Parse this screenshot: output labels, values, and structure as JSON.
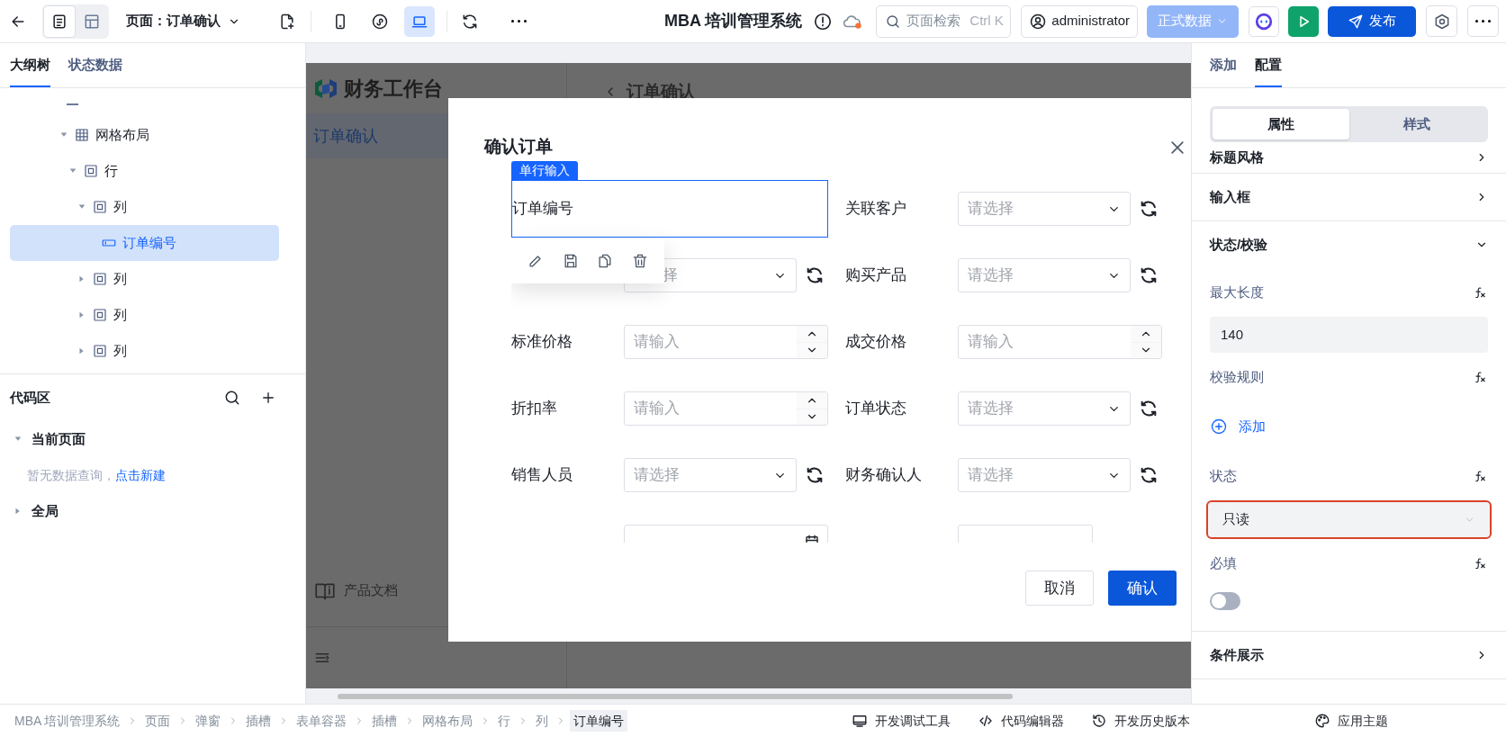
{
  "topbar": {
    "view_modes": [
      {
        "kind": "outline",
        "selected": true
      },
      {
        "kind": "layout",
        "selected": false
      }
    ],
    "page_selector": "页面：订单确认",
    "devices": [
      {
        "kind": "mobile",
        "selected": false
      },
      {
        "kind": "miniprogram",
        "selected": false
      },
      {
        "kind": "desktop",
        "selected": true
      }
    ],
    "app_title": "MBA 培训管理系统",
    "search": {
      "placeholder": "页面检索",
      "shortcut": "Ctrl K"
    },
    "user": "administrator",
    "data_env": {
      "label": "正式数据",
      "disabled": true
    },
    "publish": "发布"
  },
  "left_panel": {
    "tabs": [
      {
        "label": "大纲树",
        "selected": true
      },
      {
        "label": "状态数据",
        "selected": false
      }
    ],
    "tree": [
      {
        "label": "网格布局",
        "kind": "grid",
        "expanded": true,
        "selected": false,
        "children": [
          {
            "label": "行",
            "kind": "container",
            "expanded": true,
            "selected": false,
            "children": [
              {
                "label": "列",
                "kind": "container",
                "expanded": true,
                "selected": false,
                "children": [
                  {
                    "label": "订单编号",
                    "kind": "input",
                    "selected": true
                  }
                ]
              },
              {
                "label": "列",
                "kind": "container",
                "expanded": false,
                "selected": false
              },
              {
                "label": "列",
                "kind": "container",
                "expanded": false,
                "selected": false
              },
              {
                "label": "列",
                "kind": "container",
                "expanded": false,
                "selected": false
              }
            ]
          }
        ]
      }
    ],
    "code_area": {
      "title": "代码区",
      "groups": [
        {
          "label": "当前页面",
          "expanded": true,
          "empty_text": "暂无数据查询，",
          "link": "点击新建"
        },
        {
          "label": "全局",
          "expanded": false
        }
      ]
    }
  },
  "canvas": {
    "preview": {
      "logo_text": "财务工作台",
      "menu": [
        {
          "label": "订单确认",
          "selected": true
        }
      ],
      "docs_link": "产品文档",
      "header_title": "订单确认"
    },
    "modal": {
      "title": "确认订单",
      "selected_tag": "单行输入",
      "fields": [
        {
          "kind": "text",
          "label": "订单编号",
          "selected": true
        },
        {
          "kind": "select",
          "label": "关联客户",
          "placeholder": "请选择",
          "selected": false
        },
        {
          "kind": "select",
          "placeholder": "择",
          "selected": false
        },
        {
          "kind": "select",
          "label": "购买产品",
          "placeholder": "请选择",
          "selected": false
        },
        {
          "kind": "number",
          "label": "标准价格",
          "placeholder": "请输入",
          "selected": false
        },
        {
          "kind": "number",
          "label": "成交价格",
          "placeholder": "请输入",
          "selected": false
        },
        {
          "kind": "number",
          "label": "折扣率",
          "placeholder": "请输入",
          "selected": false
        },
        {
          "kind": "select",
          "label": "订单状态",
          "placeholder": "请选择",
          "selected": false
        },
        {
          "kind": "select",
          "label": "销售人员",
          "placeholder": "请选择",
          "selected": false
        },
        {
          "kind": "select",
          "label": "财务确认人",
          "placeholder": "请选择",
          "selected": false
        },
        {
          "kind": "date",
          "selected": false
        },
        {
          "kind": "input",
          "selected": false
        }
      ],
      "buttons": [
        {
          "label": "取消",
          "kind": "secondary"
        },
        {
          "label": "确认",
          "kind": "primary"
        }
      ]
    }
  },
  "right_panel": {
    "tabs": [
      {
        "label": "添加",
        "selected": false
      },
      {
        "label": "配置",
        "selected": true
      }
    ],
    "segments": [
      {
        "label": "属性",
        "selected": true
      },
      {
        "label": "样式",
        "selected": false
      }
    ],
    "sections": [
      {
        "title": "标题风格",
        "expanded": false
      },
      {
        "title": "输入框",
        "expanded": false
      },
      {
        "title": "状态/校验",
        "expanded": true,
        "props": [
          {
            "kind": "input",
            "label": "最大长度",
            "value": "140"
          },
          {
            "kind": "rules",
            "label": "校验规则",
            "action": "添加"
          },
          {
            "kind": "select",
            "label": "状态",
            "value": "只读",
            "highlighted": true
          },
          {
            "kind": "switch",
            "label": "必填",
            "on": false
          }
        ]
      },
      {
        "title": "条件展示",
        "expanded": false
      }
    ]
  },
  "status_bar": {
    "breadcrumb": [
      {
        "label": "MBA 培训管理系统",
        "selected": false
      },
      {
        "label": "页面",
        "selected": false
      },
      {
        "label": "弹窗",
        "selected": false
      },
      {
        "label": "插槽",
        "selected": false
      },
      {
        "label": "表单容器",
        "selected": false
      },
      {
        "label": "插槽",
        "selected": false
      },
      {
        "label": "网格布局",
        "selected": false
      },
      {
        "label": "行",
        "selected": false
      },
      {
        "label": "列",
        "selected": false
      },
      {
        "label": "订单编号",
        "selected": true
      }
    ],
    "tools": [
      {
        "kind": "debug",
        "label": "开发调试工具"
      },
      {
        "kind": "code",
        "label": "代码编辑器"
      },
      {
        "kind": "history",
        "label": "开发历史版本"
      },
      {
        "kind": "theme",
        "label": "应用主题"
      }
    ]
  }
}
